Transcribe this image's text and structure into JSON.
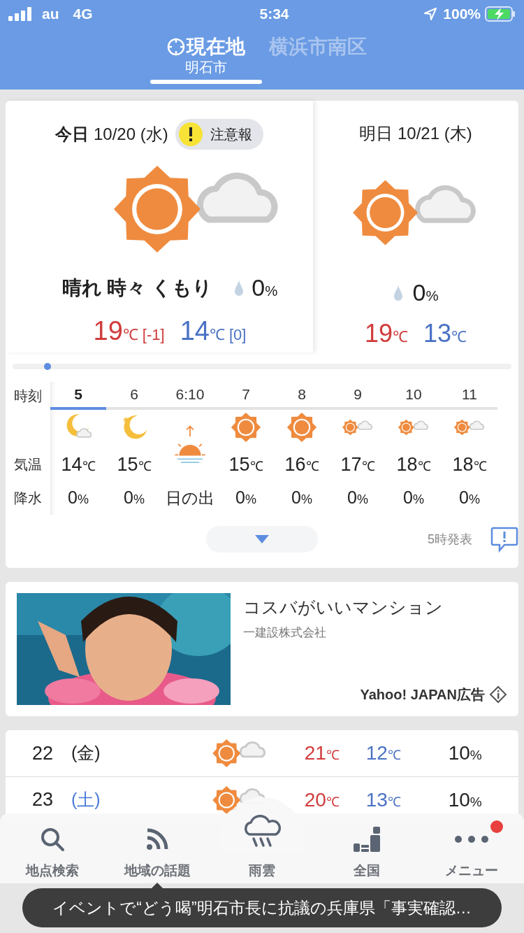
{
  "status_bar": {
    "carrier": "au",
    "network": "4G",
    "time": "5:34",
    "battery": "100%"
  },
  "tabs": [
    {
      "title": "現在地",
      "subtitle": "明石市",
      "selected": true,
      "kind": "location"
    },
    {
      "title": "横浜市南区",
      "selected": false,
      "kind": "place"
    }
  ],
  "today": {
    "label": "今日",
    "date": "10/20 (水)",
    "alert": "注意報",
    "kind": "sun_cloud",
    "weather": "晴れ 時々 くもり",
    "rain": "0",
    "rain_unit": "%",
    "high": "19",
    "high_unit": "℃",
    "high_diff": "[-1]",
    "low": "14",
    "low_unit": "℃",
    "low_diff": "[0]"
  },
  "tomorrow": {
    "label": "明日 10/21 (木)",
    "kind": "sun_cloud",
    "rain": "0",
    "rain_unit": "%",
    "high": "19",
    "high_unit": "℃",
    "low": "13",
    "low_unit": "℃"
  },
  "timeline": {
    "level": 0.07
  },
  "hourly": {
    "row_labels": [
      "時刻",
      "気温",
      "降水"
    ],
    "hours": [
      {
        "time": "5",
        "selected": true,
        "kind": "moon_cloud",
        "temp": "14",
        "unit": "℃",
        "rain": "0",
        "rain_unit": "%"
      },
      {
        "time": "6",
        "selected": false,
        "kind": "moon_star",
        "temp": "15",
        "unit": "℃",
        "rain": "0",
        "rain_unit": "%"
      },
      {
        "time": "6:10",
        "selected": false,
        "kind": "sunrise",
        "event": "日の出"
      },
      {
        "time": "7",
        "selected": false,
        "kind": "sun",
        "temp": "15",
        "unit": "℃",
        "rain": "0",
        "rain_unit": "%"
      },
      {
        "time": "8",
        "selected": false,
        "kind": "sun",
        "temp": "16",
        "unit": "℃",
        "rain": "0",
        "rain_unit": "%"
      },
      {
        "time": "9",
        "selected": false,
        "kind": "sun_cloud",
        "temp": "17",
        "unit": "℃",
        "rain": "0",
        "rain_unit": "%"
      },
      {
        "time": "10",
        "selected": false,
        "kind": "sun_cloud",
        "temp": "18",
        "unit": "℃",
        "rain": "0",
        "rain_unit": "%"
      },
      {
        "time": "11",
        "selected": false,
        "kind": "sun_cloud",
        "temp": "18",
        "unit": "℃",
        "rain": "0",
        "rain_unit": "%"
      }
    ]
  },
  "issued": "5時発表",
  "ad": {
    "title": "コスバがいいマンション",
    "advertiser": "一建設株式会社",
    "label": "Yahoo! JAPAN広告"
  },
  "weekly": [
    {
      "day": "22",
      "weekday": "(金)",
      "color": "#222222",
      "kind": "sun_cloud",
      "high": "21",
      "high_unit": "℃",
      "low": "12",
      "low_unit": "℃",
      "rain": "10",
      "rain_unit": "%"
    },
    {
      "day": "23",
      "weekday": "(土)",
      "color": "#4a7ad8",
      "kind": "sun_cloud",
      "high": "20",
      "high_unit": "℃",
      "low": "13",
      "low_unit": "℃",
      "rain": "10",
      "rain_unit": "%"
    }
  ],
  "nav": [
    {
      "label": "地点検索",
      "kind": "search",
      "badge": false
    },
    {
      "label": "地域の話題",
      "kind": "feed",
      "badge": false
    },
    {
      "label": "雨雲",
      "kind": "rain",
      "badge": false
    },
    {
      "label": "全国",
      "kind": "map",
      "badge": false
    },
    {
      "label": "メニュー",
      "kind": "dots",
      "badge": true
    }
  ],
  "toast": "イベントで“どう喝”明石市長に抗議の兵庫県「事実確認…"
}
